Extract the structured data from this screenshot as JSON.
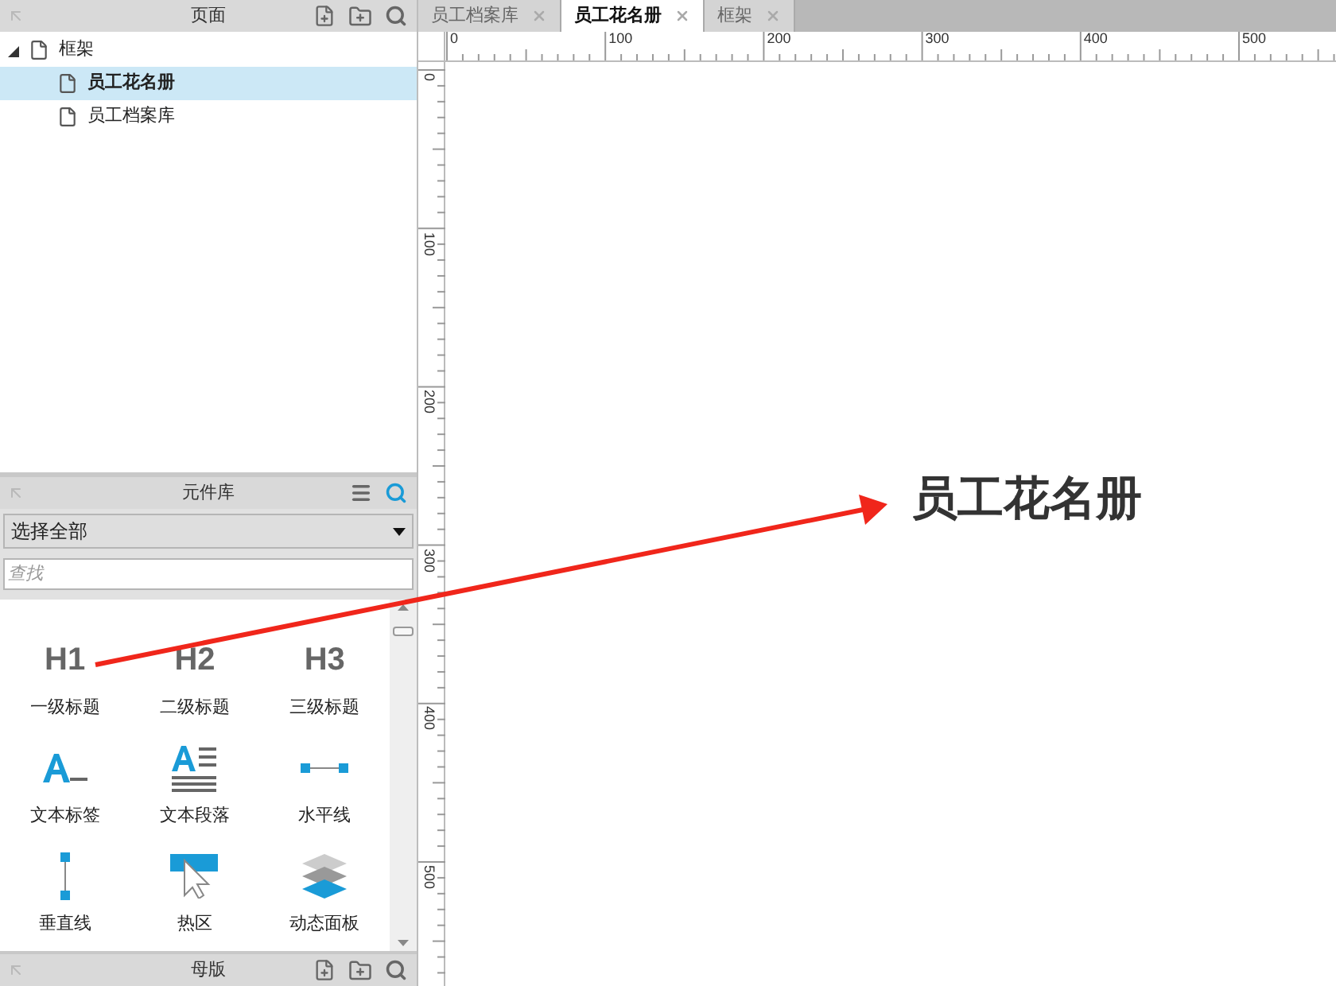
{
  "pages_panel": {
    "title": "页面",
    "tree": [
      {
        "label": "框架",
        "expanded": true,
        "selected": false,
        "children": [
          {
            "label": "员工花名册",
            "selected": true
          },
          {
            "label": "员工档案库",
            "selected": false
          }
        ]
      }
    ]
  },
  "library_panel": {
    "title": "元件库",
    "filter": {
      "value": "选择全部"
    },
    "search": {
      "placeholder": "查找"
    },
    "widgets": [
      {
        "kind": "heading",
        "glyph": "H1",
        "label": "一级标题"
      },
      {
        "kind": "heading",
        "glyph": "H2",
        "label": "二级标题"
      },
      {
        "kind": "heading",
        "glyph": "H3",
        "label": "三级标题"
      },
      {
        "kind": "label",
        "label": "文本标签"
      },
      {
        "kind": "paragraph",
        "label": "文本段落"
      },
      {
        "kind": "hline",
        "label": "水平线"
      },
      {
        "kind": "vline",
        "label": "垂直线"
      },
      {
        "kind": "hotspot",
        "label": "热区"
      },
      {
        "kind": "panel",
        "label": "动态面板"
      }
    ]
  },
  "masters_panel": {
    "title": "母版"
  },
  "tabs": [
    {
      "label": "员工档案库",
      "selected": false
    },
    {
      "label": "员工花名册",
      "selected": true
    },
    {
      "label": "框架",
      "selected": false
    }
  ],
  "ruler": {
    "x_labels": [
      "0",
      "100",
      "200",
      "300",
      "400",
      "500"
    ],
    "y_labels": [
      "0",
      "100",
      "200",
      "300",
      "400",
      "500"
    ]
  },
  "canvas": {
    "heading": "员工花名册"
  }
}
